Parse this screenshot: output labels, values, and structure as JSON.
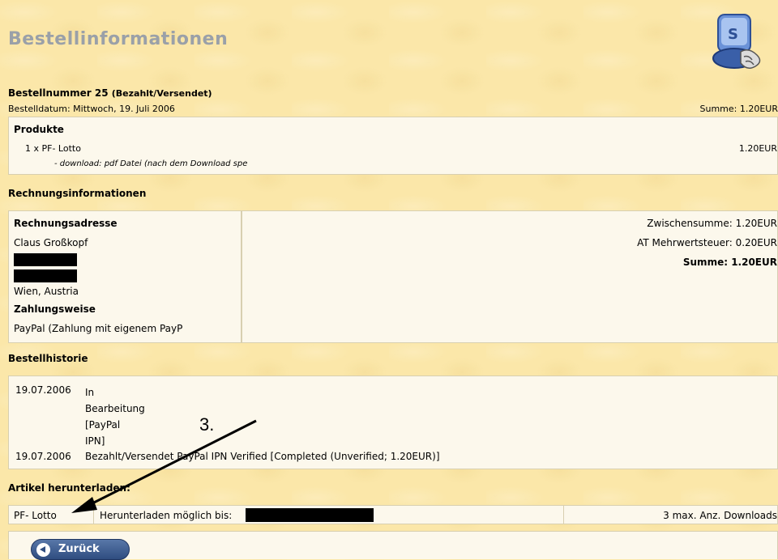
{
  "page": {
    "title": "Bestellinformationen",
    "order_heading": "Bestellnummer 25",
    "order_status": "(Bezahlt/Versendet)",
    "order_date": "Bestelldatum: Mittwoch, 19. Juli 2006",
    "order_total": "Summe: 1.20EUR"
  },
  "products": {
    "heading": "Produkte",
    "line": "1 x PF- Lotto",
    "price": "1.20EUR",
    "note": "- download: pdf Datei (nach dem Download spe"
  },
  "billing": {
    "section": "Rechnungsinformationen",
    "address_heading": "Rechnungsadresse",
    "name": "Claus Großkopf",
    "city": "Wien, Austria",
    "payment_heading": "Zahlungsweise",
    "payment": "PayPal (Zahlung mit eigenem PayP",
    "subtotal": "Zwischensumme: 1.20EUR",
    "tax": "AT Mehrwertsteuer: 0.20EUR",
    "total_label": "Summe:",
    "total_value": "1.20EUR"
  },
  "history": {
    "section": "Bestellhistorie",
    "rows": [
      {
        "date": "19.07.2006",
        "lines": [
          "In",
          "Bearbeitung",
          "[PayPal",
          "IPN]"
        ]
      },
      {
        "date": "19.07.2006",
        "text": "Bezahlt/Versendet PayPal IPN Verified [Completed (Unverified; 1.20EUR)]"
      }
    ]
  },
  "downloads": {
    "section": "Artikel herunterladen:",
    "product": "PF- Lotto",
    "available_until": "Herunterladen möglich bis:",
    "max": "3 max. Anz. Downloads"
  },
  "annotation": "3.",
  "back_button": "Zurück"
}
